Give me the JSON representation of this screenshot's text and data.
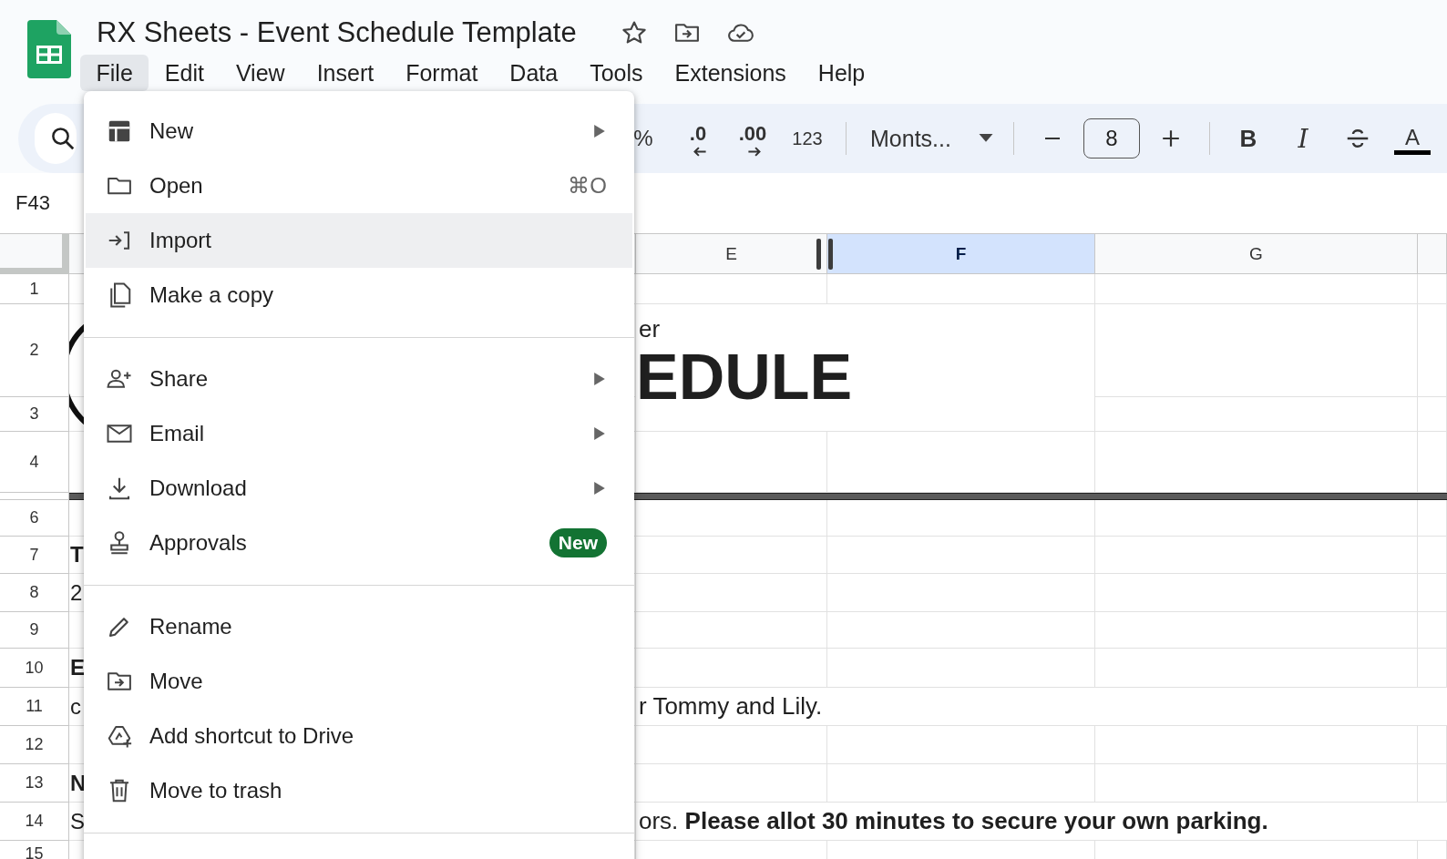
{
  "app": {
    "title": "RX Sheets - Event Schedule Template"
  },
  "menu_bar": [
    {
      "label": "File",
      "selected": true
    },
    {
      "label": "Edit",
      "selected": false
    },
    {
      "label": "View",
      "selected": false
    },
    {
      "label": "Insert",
      "selected": false
    },
    {
      "label": "Format",
      "selected": false
    },
    {
      "label": "Data",
      "selected": false
    },
    {
      "label": "Tools",
      "selected": false
    },
    {
      "label": "Extensions",
      "selected": false
    },
    {
      "label": "Help",
      "selected": false
    }
  ],
  "toolbar": {
    "percent": "%",
    "decrease_decimal": ".0",
    "increase_decimal": ".00",
    "number_format": "123",
    "font": "Monts...",
    "font_size": "8",
    "bold": "B",
    "italic": "I",
    "text_color": "A"
  },
  "name_box": "F43",
  "columns": [
    {
      "label": "E",
      "selected": false
    },
    {
      "label": "F",
      "selected": true
    },
    {
      "label": "G",
      "selected": false
    }
  ],
  "rows": [
    {
      "number": "1"
    },
    {
      "number": "2",
      "e": "er",
      "e_heading": "EDULE"
    },
    {
      "number": "3"
    },
    {
      "number": "4"
    },
    {
      "number": "6"
    },
    {
      "number": "7",
      "a": "T",
      "a_bold": true
    },
    {
      "number": "8",
      "a": "2",
      "a_bold": false
    },
    {
      "number": "9"
    },
    {
      "number": "10",
      "a": "E",
      "a_bold": true
    },
    {
      "number": "11",
      "a": "c",
      "a_bold": false,
      "e": "r Tommy and Lily."
    },
    {
      "number": "12"
    },
    {
      "number": "13",
      "a": "N",
      "a_bold": true
    },
    {
      "number": "14",
      "a": "S",
      "a_bold": false,
      "e": "ors. **Please allot 30 minutes to secure your own parking.**"
    },
    {
      "number": "15"
    }
  ],
  "file_menu": {
    "groups": [
      [
        {
          "label": "New",
          "submenu": true,
          "highlighted": false
        },
        {
          "label": "Open",
          "shortcut": "⌘O",
          "submenu": false,
          "highlighted": false
        },
        {
          "label": "Import",
          "submenu": false,
          "highlighted": true
        },
        {
          "label": "Make a copy",
          "submenu": false,
          "highlighted": false
        }
      ],
      [
        {
          "label": "Share",
          "submenu": true,
          "highlighted": false
        },
        {
          "label": "Email",
          "submenu": true,
          "highlighted": false
        },
        {
          "label": "Download",
          "submenu": true,
          "highlighted": false
        },
        {
          "label": "Approvals",
          "badge": "New",
          "submenu": false,
          "highlighted": false
        }
      ],
      [
        {
          "label": "Rename",
          "submenu": false,
          "highlighted": false
        },
        {
          "label": "Move",
          "submenu": false,
          "highlighted": false
        },
        {
          "label": "Add shortcut to Drive",
          "submenu": false,
          "highlighted": false
        },
        {
          "label": "Move to trash",
          "submenu": false,
          "highlighted": false
        }
      ]
    ]
  }
}
